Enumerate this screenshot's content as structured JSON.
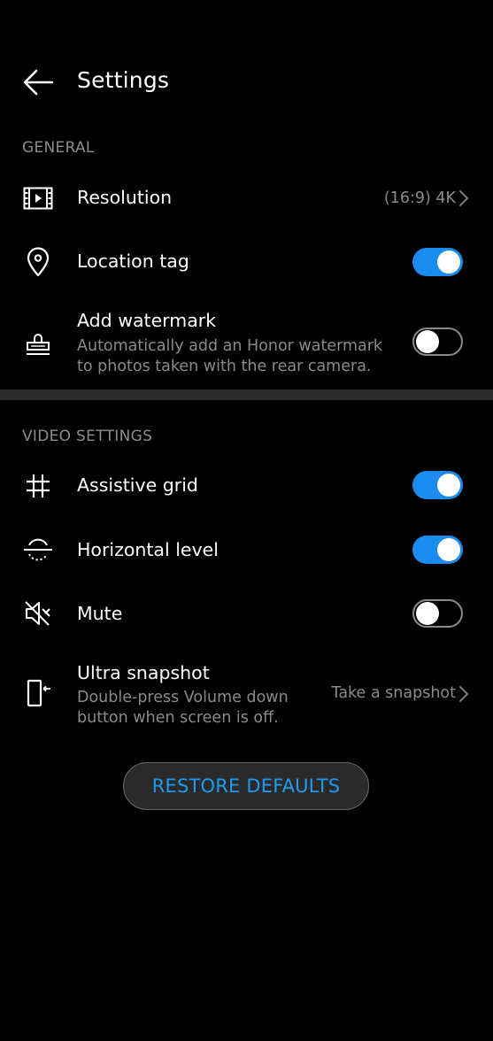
{
  "header": {
    "title": "Settings",
    "back_icon": "arrow-left-icon"
  },
  "general": {
    "section_title": "GENERAL",
    "resolution": {
      "title": "Resolution",
      "value": "(16:9) 4K",
      "icon": "video-frame-icon"
    },
    "location_tag": {
      "title": "Location tag",
      "enabled": true,
      "icon": "location-pin-icon"
    },
    "watermark": {
      "title": "Add watermark",
      "sub_line1": "Automatically add an Honor watermark",
      "sub_line2": "to photos taken with the rear camera.",
      "enabled": false,
      "icon": "stamp-icon"
    }
  },
  "video": {
    "section_title": "VIDEO SETTINGS",
    "assistive_grid": {
      "title": "Assistive grid",
      "enabled": true,
      "icon": "grid-icon"
    },
    "horizontal_level": {
      "title": "Horizontal level",
      "enabled": true,
      "icon": "level-icon"
    },
    "mute": {
      "title": "Mute",
      "enabled": false,
      "icon": "speaker-mute-icon"
    },
    "ultra_snapshot": {
      "title": "Ultra snapshot",
      "sub_line1": "Double-press Volume down",
      "sub_line2": "button when screen is off.",
      "value": "Take a snapshot",
      "icon": "phone-snapshot-icon"
    }
  },
  "footer": {
    "restore_label": "RESTORE DEFAULTS"
  },
  "colors": {
    "background": "#000000",
    "accent": "#1a8cf0",
    "button_text": "#1e9bf0",
    "secondary_text": "#8a8a8a"
  }
}
